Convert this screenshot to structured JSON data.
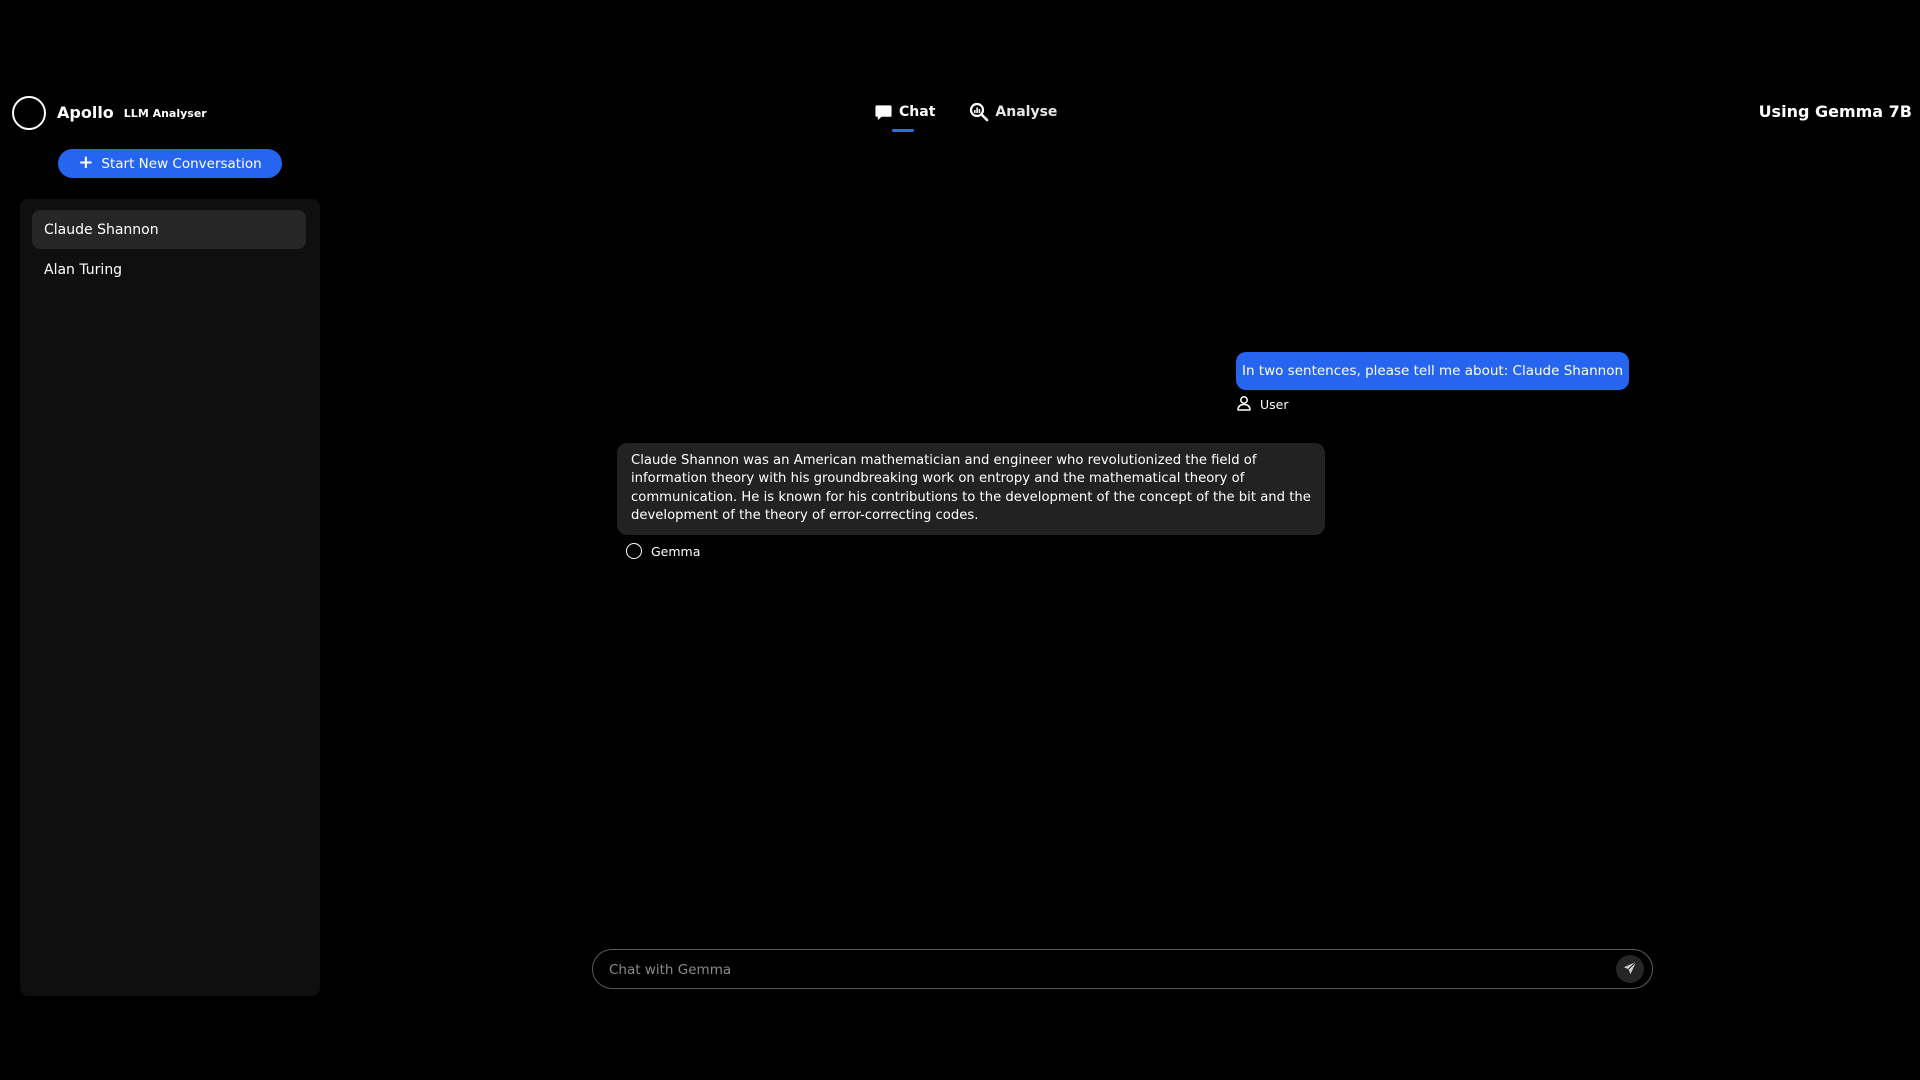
{
  "header": {
    "app_name": "Apollo",
    "app_subtitle": "LLM Analyser",
    "tabs": [
      {
        "label": "Chat",
        "icon": "chat-bubble-icon",
        "active": true
      },
      {
        "label": "Analyse",
        "icon": "magnify-analyse-icon",
        "active": false
      }
    ],
    "model_label": "Using Gemma 7B"
  },
  "sidebar": {
    "new_conversation_label": "Start New Conversation",
    "conversations": [
      {
        "label": "Claude Shannon",
        "active": true
      },
      {
        "label": "Alan Turing",
        "active": false
      }
    ]
  },
  "chat": {
    "messages": [
      {
        "role": "user",
        "author": "User",
        "text": "In two sentences, please tell me about: Claude Shannon"
      },
      {
        "role": "assistant",
        "author": "Gemma",
        "text": "Claude Shannon was an American mathematician and engineer who revolutionized the field of information theory with his groundbreaking work on entropy and the mathematical theory of communication. He is known for his contributions to the development of the concept of the bit and the development of the theory of error-correcting codes."
      }
    ],
    "input": {
      "value": "",
      "placeholder": "Chat with Gemma"
    }
  },
  "colors": {
    "accent": "#2565f0",
    "background": "#000000",
    "sidebar_bg": "#0f0f0f",
    "bot_bubble": "#222222"
  }
}
